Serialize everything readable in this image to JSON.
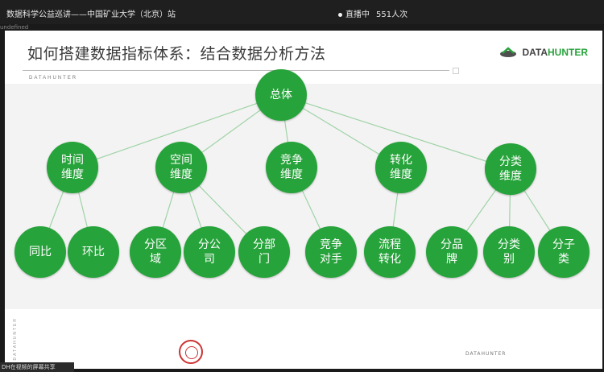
{
  "topbar": {
    "title": "数据科学公益巡讲——中国矿业大学（北京）站",
    "live_label": "直播中",
    "viewers": "551人次"
  },
  "misc": {
    "undefined_text": "undefined",
    "share_text": "DH在视频的屏幕共享"
  },
  "slide": {
    "title": "如何搭建数据指标体系：结合数据分析方法",
    "logo": {
      "dark": "DATA",
      "green": "HUNTER",
      "icon": "datahunter-logo-icon"
    },
    "sub_label": "DATAHUNTER",
    "vertical_label": "DATAHUNTER",
    "bottom_text": "DATAHUNTER",
    "seal_icon": "university-seal-icon"
  },
  "tree": {
    "root": "总体",
    "level1": [
      "时间\n维度",
      "空间\n维度",
      "竞争\n维度",
      "转化\n维度",
      "分类\n维度"
    ],
    "level2": [
      "同比",
      "环比",
      "分区\n域",
      "分公\n司",
      "分部\n门",
      "竞争\n对手",
      "流程\n转化",
      "分品\n牌",
      "分类\n别",
      "分子\n类"
    ],
    "links": [
      [
        0,
        0
      ],
      [
        0,
        1
      ],
      [
        1,
        2
      ],
      [
        1,
        3
      ],
      [
        1,
        4
      ],
      [
        2,
        5
      ],
      [
        3,
        6
      ],
      [
        4,
        7
      ],
      [
        4,
        8
      ],
      [
        4,
        9
      ]
    ]
  },
  "colors": {
    "node": "#27a33b",
    "line": "#9fd3a6"
  }
}
